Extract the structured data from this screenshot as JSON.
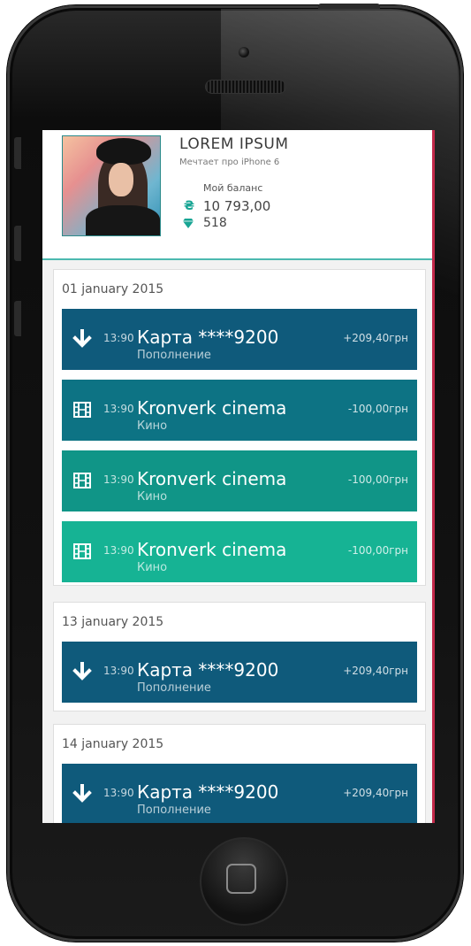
{
  "profile": {
    "name": "LOREM IPSUM",
    "subtitle": "Мечтает про iPhone 6",
    "balance_label": "Мой баланс",
    "balance": "10 793,00",
    "gems": "518",
    "currency_icon": "hryvnia-icon",
    "gem_icon": "diamond-icon",
    "accent": "#18a594"
  },
  "days": [
    {
      "date": "01 january 2015",
      "transactions": [
        {
          "icon": "arrow-down-icon",
          "time": "13:90",
          "title": "Карта ****9200",
          "subtitle": "Пополнение",
          "amount": "+209,40грн",
          "color": "#0f5a7b"
        },
        {
          "icon": "film-icon",
          "time": "13:90",
          "title": "Kronverk cinema",
          "subtitle": "Кино",
          "amount": "-100,00грн",
          "color": "#0d7384"
        },
        {
          "icon": "film-icon",
          "time": "13:90",
          "title": "Kronverk cinema",
          "subtitle": "Кино",
          "amount": "-100,00грн",
          "color": "#109587"
        },
        {
          "icon": "film-icon",
          "time": "13:90",
          "title": "Kronverk cinema",
          "subtitle": "Кино",
          "amount": "-100,00грн",
          "color": "#16b394"
        }
      ]
    },
    {
      "date": "13 january 2015",
      "transactions": [
        {
          "icon": "arrow-down-icon",
          "time": "13:90",
          "title": "Карта ****9200",
          "subtitle": "Пополнение",
          "amount": "+209,40грн",
          "color": "#0f5a7b"
        }
      ]
    },
    {
      "date": "14 january 2015",
      "transactions": [
        {
          "icon": "arrow-down-icon",
          "time": "13:90",
          "title": "Карта ****9200",
          "subtitle": "Пополнение",
          "amount": "+209,40грн",
          "color": "#0f5a7b"
        }
      ]
    }
  ]
}
